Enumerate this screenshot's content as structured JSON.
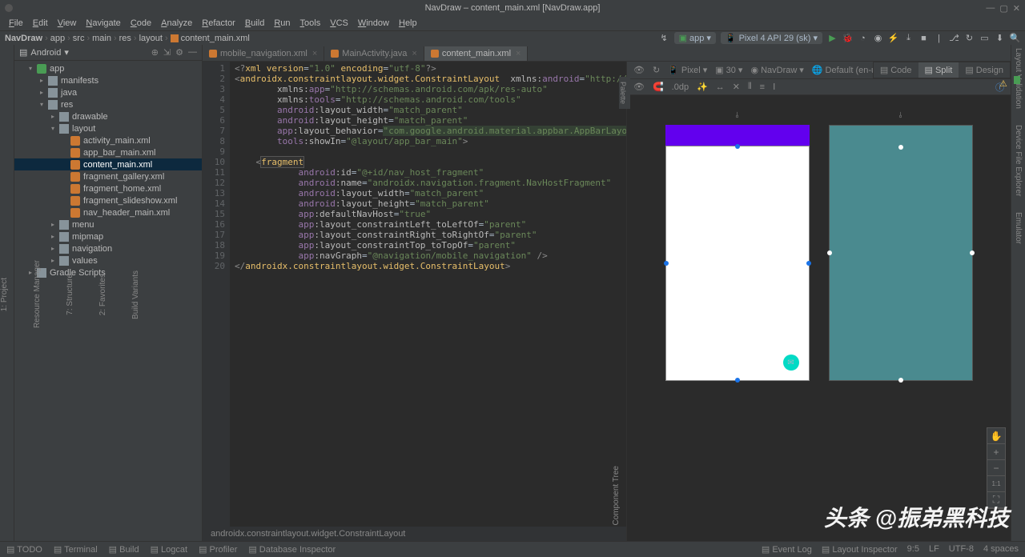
{
  "titlebar": {
    "title": "NavDraw – content_main.xml [NavDraw.app]"
  },
  "menubar": [
    "File",
    "Edit",
    "View",
    "Navigate",
    "Code",
    "Analyze",
    "Refactor",
    "Build",
    "Run",
    "Tools",
    "VCS",
    "Window",
    "Help"
  ],
  "breadcrumb": [
    "NavDraw",
    "app",
    "src",
    "main",
    "res",
    "layout",
    "content_main.xml"
  ],
  "run_config": {
    "label": "app"
  },
  "device_config": {
    "label": "Pixel 4 API 29 (sk)"
  },
  "project": {
    "view": "Android",
    "tree": [
      {
        "d": 1,
        "icon": "mod",
        "label": "app",
        "arrow": "▾"
      },
      {
        "d": 2,
        "icon": "folder",
        "label": "manifests",
        "arrow": "▸"
      },
      {
        "d": 2,
        "icon": "folder",
        "label": "java",
        "arrow": "▸"
      },
      {
        "d": 2,
        "icon": "folder",
        "label": "res",
        "arrow": "▾"
      },
      {
        "d": 3,
        "icon": "folder",
        "label": "drawable",
        "arrow": "▸"
      },
      {
        "d": 3,
        "icon": "folder",
        "label": "layout",
        "arrow": "▾"
      },
      {
        "d": 4,
        "icon": "xml",
        "label": "activity_main.xml"
      },
      {
        "d": 4,
        "icon": "xml",
        "label": "app_bar_main.xml"
      },
      {
        "d": 4,
        "icon": "xml",
        "label": "content_main.xml",
        "selected": true
      },
      {
        "d": 4,
        "icon": "xml",
        "label": "fragment_gallery.xml"
      },
      {
        "d": 4,
        "icon": "xml",
        "label": "fragment_home.xml"
      },
      {
        "d": 4,
        "icon": "xml",
        "label": "fragment_slideshow.xml"
      },
      {
        "d": 4,
        "icon": "xml",
        "label": "nav_header_main.xml"
      },
      {
        "d": 3,
        "icon": "folder",
        "label": "menu",
        "arrow": "▸"
      },
      {
        "d": 3,
        "icon": "folder",
        "label": "mipmap",
        "arrow": "▸"
      },
      {
        "d": 3,
        "icon": "folder",
        "label": "navigation",
        "arrow": "▸"
      },
      {
        "d": 3,
        "icon": "folder",
        "label": "values",
        "arrow": "▸"
      },
      {
        "d": 1,
        "icon": "folder",
        "label": "Gradle Scripts",
        "arrow": "▸"
      }
    ]
  },
  "editor_tabs": [
    {
      "label": "mobile_navigation.xml"
    },
    {
      "label": "MainActivity.java"
    },
    {
      "label": "content_main.xml",
      "active": true
    }
  ],
  "view_modes": [
    {
      "label": "Code"
    },
    {
      "label": "Split",
      "active": true
    },
    {
      "label": "Design"
    }
  ],
  "code_lines_count": 20,
  "status_hint": "androidx.constraintlayout.widget.ConstraintLayout",
  "design_toolbar": {
    "device": "Pixel",
    "api": "30",
    "theme": "NavDraw",
    "locale": "Default (en-us)",
    "zoom": ".0dp"
  },
  "statusbar": {
    "left": [
      "TODO",
      "Terminal",
      "Build",
      "Logcat",
      "Profiler",
      "Database Inspector"
    ],
    "right": [
      "Event Log",
      "Layout Inspector"
    ],
    "info": [
      "9:5",
      "LF",
      "UTF-8",
      "4 spaces"
    ]
  },
  "watermark": "头条 @振弟黑科技",
  "palette_label": "Palette",
  "component_tree_label": "Component Tree",
  "leftgutter": [
    "1: Project",
    "Resource Manager",
    "7: Structure",
    "2: Favorites",
    "Build Variants"
  ]
}
